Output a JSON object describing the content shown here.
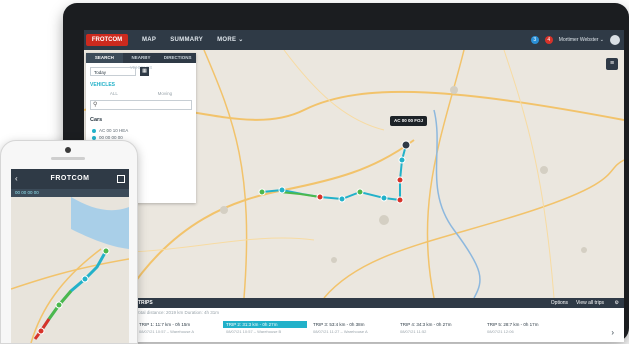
{
  "app": {
    "brand": "FROTCOM",
    "nav": [
      "MAP",
      "SUMMARY",
      "MORE ⌄"
    ],
    "notifications": {
      "messages": "3",
      "alerts": "4"
    },
    "user_label": "Mortimer Webster ⌄",
    "colors": {
      "accent": "#22b1c9",
      "brand": "#cc2a1e",
      "navbar": "#2f3a46"
    }
  },
  "sidepanel": {
    "tabs": [
      "SEARCH",
      "NEARBY VEHICLES",
      "DIRECTIONS"
    ],
    "date_value": "Today",
    "vehicle_label": "VEHICLES",
    "filters": [
      "ALL",
      "Moving"
    ],
    "search_placeholder": "",
    "group_label": "Cars",
    "vehicles": [
      "AC 00 10 HEA",
      "00 00 00 00"
    ]
  },
  "map": {
    "vehicle_tag": "AC 00 00 FOJ",
    "toggle_icon": "layers-icon"
  },
  "trips_panel": {
    "title": "TRIPS",
    "options_label": "Options",
    "view_all_label": "View all trips",
    "summary_text": "Total distance: 2019 km   Duration: 4h 31m",
    "trips": [
      {
        "label": "TRIP 1: 11:7 km - 0h 15m",
        "time": "08/07/21 10:57 – Warehouse A"
      },
      {
        "label": "TRIP 2: 31:3 km - 0h 27m",
        "time": "08/07/21 10:57 – Warehouse B"
      },
      {
        "label": "TRIP 3: 53:4 km - 0h 38m",
        "time": "08/07/21 11:27 – Warehouse A"
      },
      {
        "label": "TRIP 4: 34:3 km - 0h 27m",
        "time": "08/07/21 11:52"
      },
      {
        "label": "TRIP 5: 28:7 km - 0h 17m",
        "time": "08/07/21 12:06"
      }
    ]
  },
  "phone": {
    "title": "FROTCOM",
    "subtitle": "00 00 00 00"
  }
}
